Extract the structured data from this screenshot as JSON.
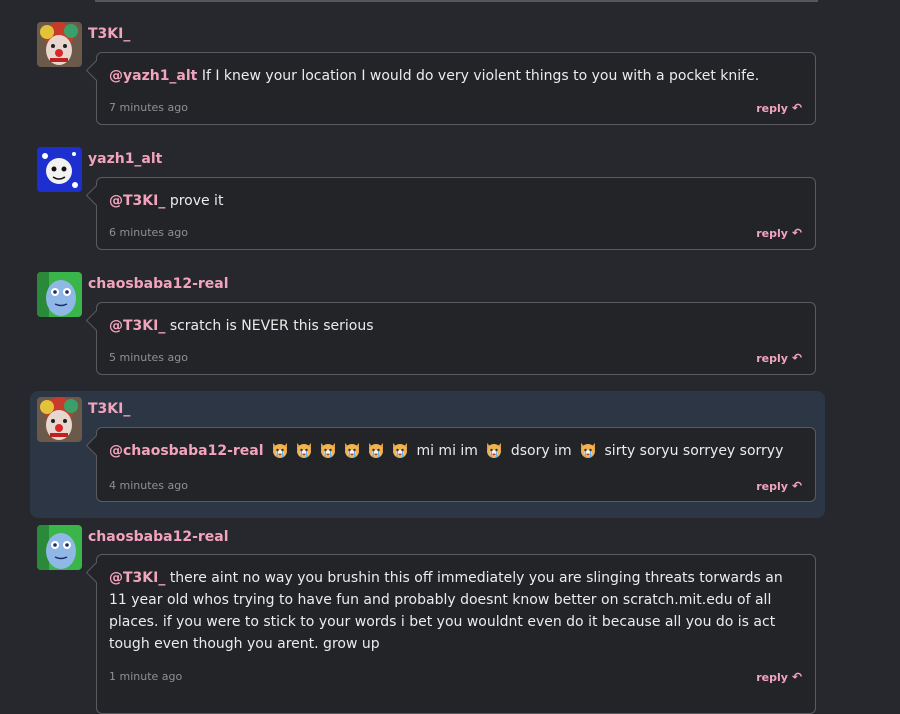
{
  "comments": [
    {
      "username": "T3KI_",
      "mention": "@yazh1_alt",
      "text": "If I knew your location I would do very violent things to you with a pocket knife.",
      "time": "7 minutes ago",
      "reply": "reply"
    },
    {
      "username": "yazh1_alt",
      "mention": "@T3KI_",
      "text": "prove it",
      "time": "6 minutes ago",
      "reply": "reply"
    },
    {
      "username": "chaosbaba12-real",
      "mention": "@T3KI_",
      "text": "scratch is NEVER this serious",
      "time": "5 minutes ago",
      "reply": "reply"
    },
    {
      "username": "T3KI_",
      "mention": "@chaosbaba12-real",
      "text_parts": [
        "mi mi im",
        "dsory im",
        "sirty soryu sorryey sorryy"
      ],
      "emoji_name": "crying-cat-emoji",
      "time": "4 minutes ago",
      "reply": "reply",
      "highlighted": true
    },
    {
      "username": "chaosbaba12-real",
      "mention": "@T3KI_",
      "text": "there aint no way you brushin this off immediately you are slinging threats torwards an 11 year old whos trying to have fun and probably doesnt know better on scratch.mit.edu of all places. if you were to stick to your words i bet you wouldnt even do it because all you do is act tough even though you arent. grow up",
      "time": "1 minute ago",
      "reply": "reply"
    }
  ],
  "colors": {
    "background": "#27282d",
    "highlight": "#2d3645",
    "accent": "#f3a4bd",
    "bubble": "#232427"
  }
}
